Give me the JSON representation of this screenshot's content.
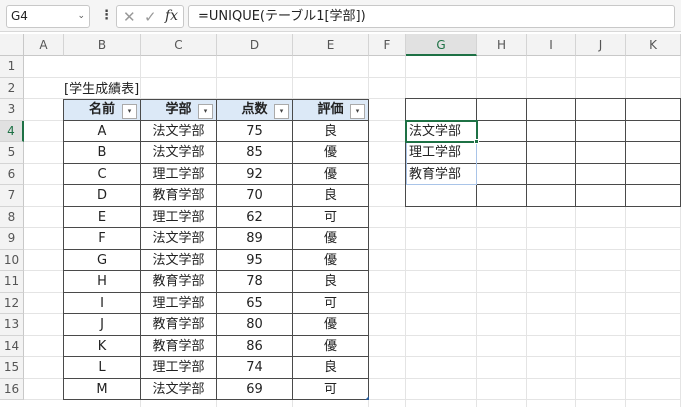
{
  "formula_bar": {
    "name_box": "G4",
    "dropdown_glyph": "⌄",
    "more_glyph": "⋮",
    "cancel_glyph": "✕",
    "enter_glyph": "✓",
    "fx_glyph": "fx",
    "formula": "=UNIQUE(テーブル1[学部])"
  },
  "columns": [
    "A",
    "B",
    "C",
    "D",
    "E",
    "F",
    "G",
    "H",
    "I",
    "J",
    "K"
  ],
  "selected_column": "G",
  "rows": [
    "1",
    "2",
    "3",
    "4",
    "5",
    "6",
    "7",
    "8",
    "9",
    "10",
    "11",
    "12",
    "13",
    "14",
    "15",
    "16"
  ],
  "selected_row": "4",
  "table_title": "[学生成績表]",
  "table": {
    "headers": [
      "名前",
      "学部",
      "点数",
      "評価"
    ],
    "filter_glyph": "▾",
    "rows": [
      [
        "A",
        "法文学部",
        "75",
        "良"
      ],
      [
        "B",
        "法文学部",
        "85",
        "優"
      ],
      [
        "C",
        "理工学部",
        "92",
        "優"
      ],
      [
        "D",
        "教育学部",
        "70",
        "良"
      ],
      [
        "E",
        "理工学部",
        "62",
        "可"
      ],
      [
        "F",
        "法文学部",
        "89",
        "優"
      ],
      [
        "G",
        "法文学部",
        "95",
        "優"
      ],
      [
        "H",
        "教育学部",
        "78",
        "良"
      ],
      [
        "I",
        "理工学部",
        "65",
        "可"
      ],
      [
        "J",
        "教育学部",
        "80",
        "優"
      ],
      [
        "K",
        "教育学部",
        "86",
        "優"
      ],
      [
        "L",
        "理工学部",
        "74",
        "良"
      ],
      [
        "M",
        "法文学部",
        "69",
        "可"
      ]
    ]
  },
  "unique_result": [
    "法文学部",
    "理工学部",
    "教育学部"
  ],
  "colors": {
    "accent": "#1e7145",
    "table_header_bg": "#dce9f7",
    "spill_border": "#a9c4e8"
  }
}
